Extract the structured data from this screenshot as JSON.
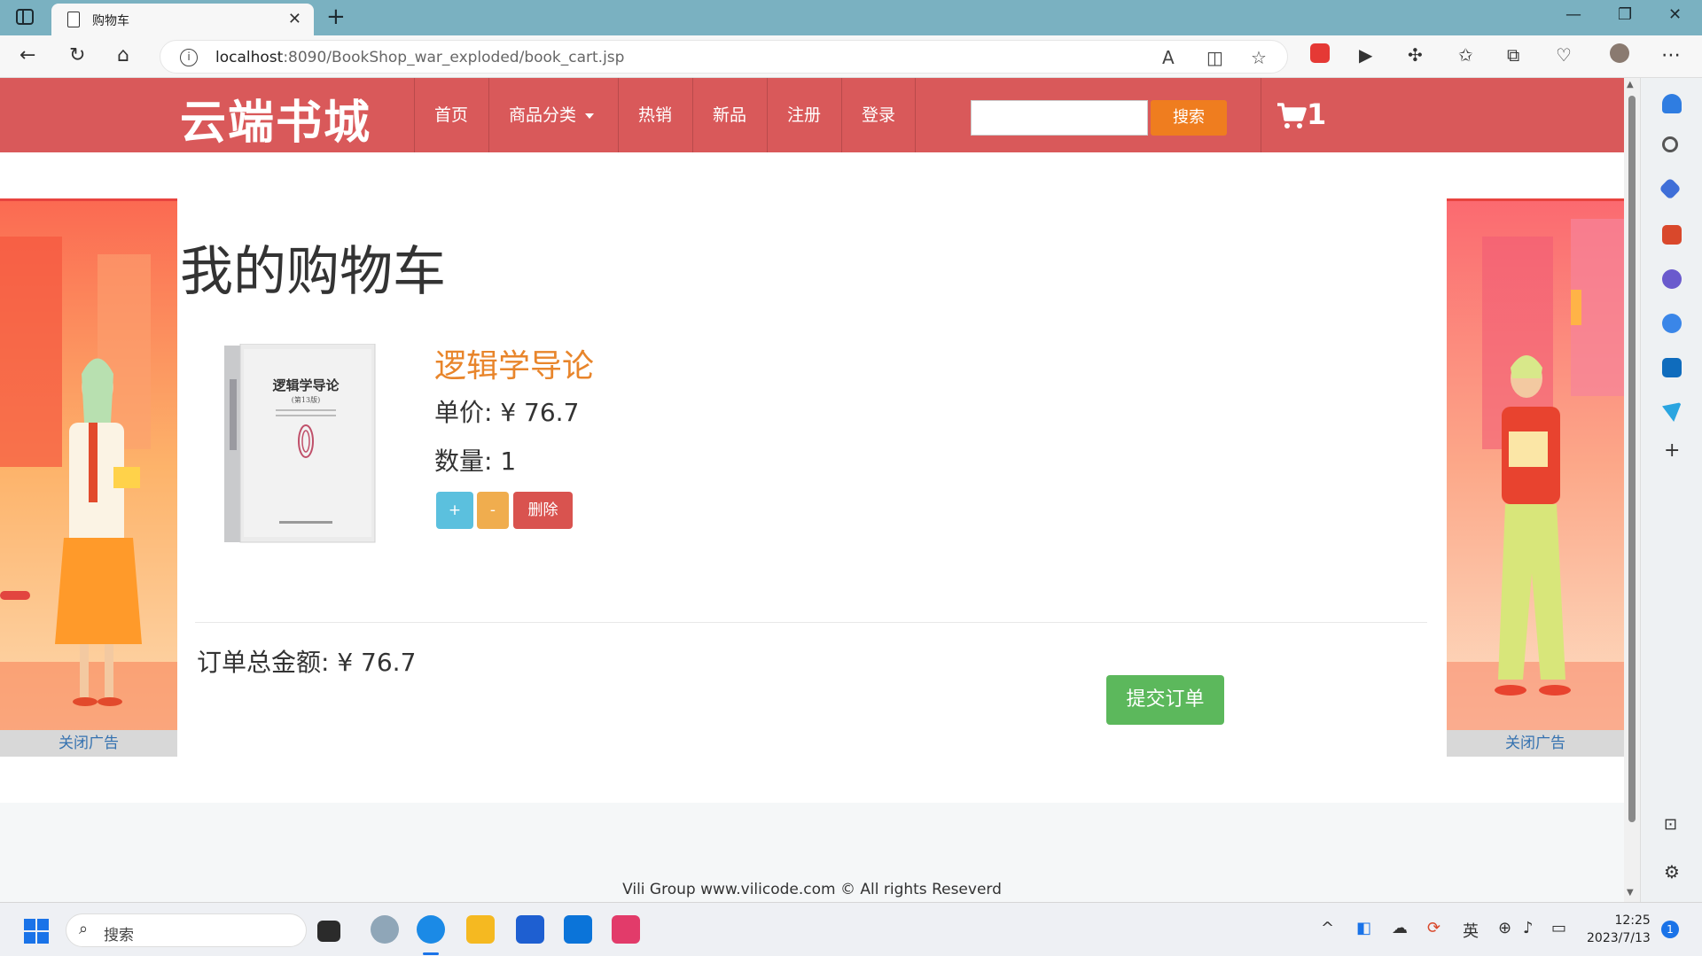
{
  "browser": {
    "tab_title": "购物车",
    "url_host": "localhost",
    "url_rest": ":8090/BookShop_war_exploded/book_cart.jsp"
  },
  "site": {
    "brand": "云端书城",
    "nav": {
      "home": "首页",
      "categories": "商品分类",
      "hot": "热销",
      "new": "新品",
      "register": "注册",
      "login": "登录"
    },
    "search_button": "搜索",
    "cart_count": "1"
  },
  "ads": {
    "close_label": "关闭广告"
  },
  "cart": {
    "title": "我的购物车",
    "item": {
      "name": "逻辑学导论",
      "price_label": "单价: ¥ 76.7",
      "quantity_label": "数量: 1",
      "plus": "+",
      "minus": "-",
      "delete": "删除",
      "cover_title": "逻辑学导论",
      "cover_edition": "(第13版)"
    },
    "total_label": "订单总金额: ¥ 76.7",
    "submit": "提交订单"
  },
  "footer": {
    "text": "Vili Group www.vilicode.com © All rights Reseverd"
  },
  "taskbar": {
    "search_placeholder": "搜索",
    "ime": "英",
    "time": "12:25",
    "date": "2023/7/13",
    "notification_count": "1"
  }
}
